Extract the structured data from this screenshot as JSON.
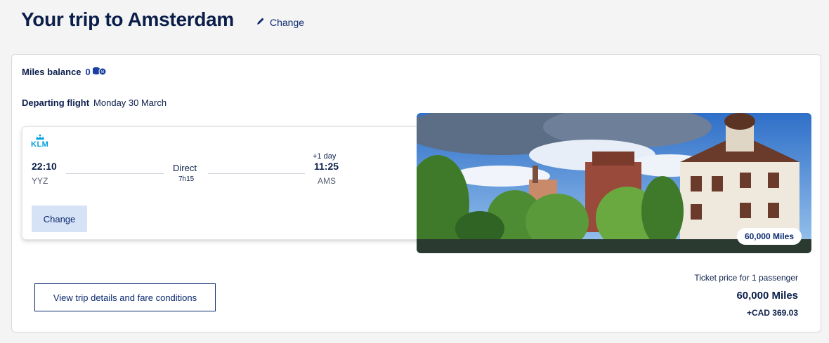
{
  "header": {
    "title": "Your trip to Amsterdam",
    "change_label": "Change"
  },
  "miles_balance": {
    "label": "Miles balance",
    "value": "0"
  },
  "departing": {
    "label": "Departing flight",
    "date": "Monday 30 March"
  },
  "flight": {
    "airline_logo": "KLM",
    "departure_time": "22:10",
    "departure_airport": "YYZ",
    "stop_type": "Direct",
    "duration": "7h15",
    "plus_day": "+1 day",
    "arrival_time": "11:25",
    "arrival_airport": "AMS",
    "change_button": "Change"
  },
  "destination_image": {
    "miles_badge": "60,000 Miles"
  },
  "trip_details_button": "View trip details and fare conditions",
  "price": {
    "caption": "Ticket price for 1 passenger",
    "miles": "60,000 Miles",
    "cash": "+CAD 369.03"
  },
  "colors": {
    "brand_navy": "#0b1e4a",
    "link_blue": "#0b2a6f",
    "klm_blue": "#00a1de",
    "button_bg": "#d6e2f5"
  }
}
